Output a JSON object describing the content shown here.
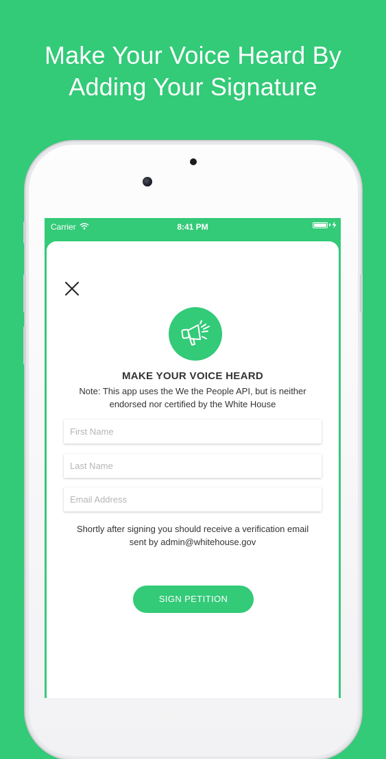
{
  "promo": {
    "headline_line1": "Make Your Voice Heard By",
    "headline_line2": "Adding Your Signature"
  },
  "status_bar": {
    "carrier": "Carrier",
    "time": "8:41 PM"
  },
  "modal": {
    "close_icon": "close-icon",
    "megaphone_icon": "megaphone-icon",
    "title": "MAKE YOUR VOICE HEARD",
    "note_line1": "Note: This app uses the We the People API, but is neither",
    "note_line2": "endorsed nor certified by the White House",
    "fields": {
      "first_name_placeholder": "First Name",
      "last_name_placeholder": "Last Name",
      "email_placeholder": "Email Address"
    },
    "info_line1": "Shortly after signing you should receive a verification email",
    "info_line2": "sent by admin@whitehouse.gov",
    "sign_button": "SIGN PETITION"
  },
  "colors": {
    "accent_green": "#33CA78",
    "card_background": "#FFFFFF",
    "text_dark": "#333333"
  }
}
